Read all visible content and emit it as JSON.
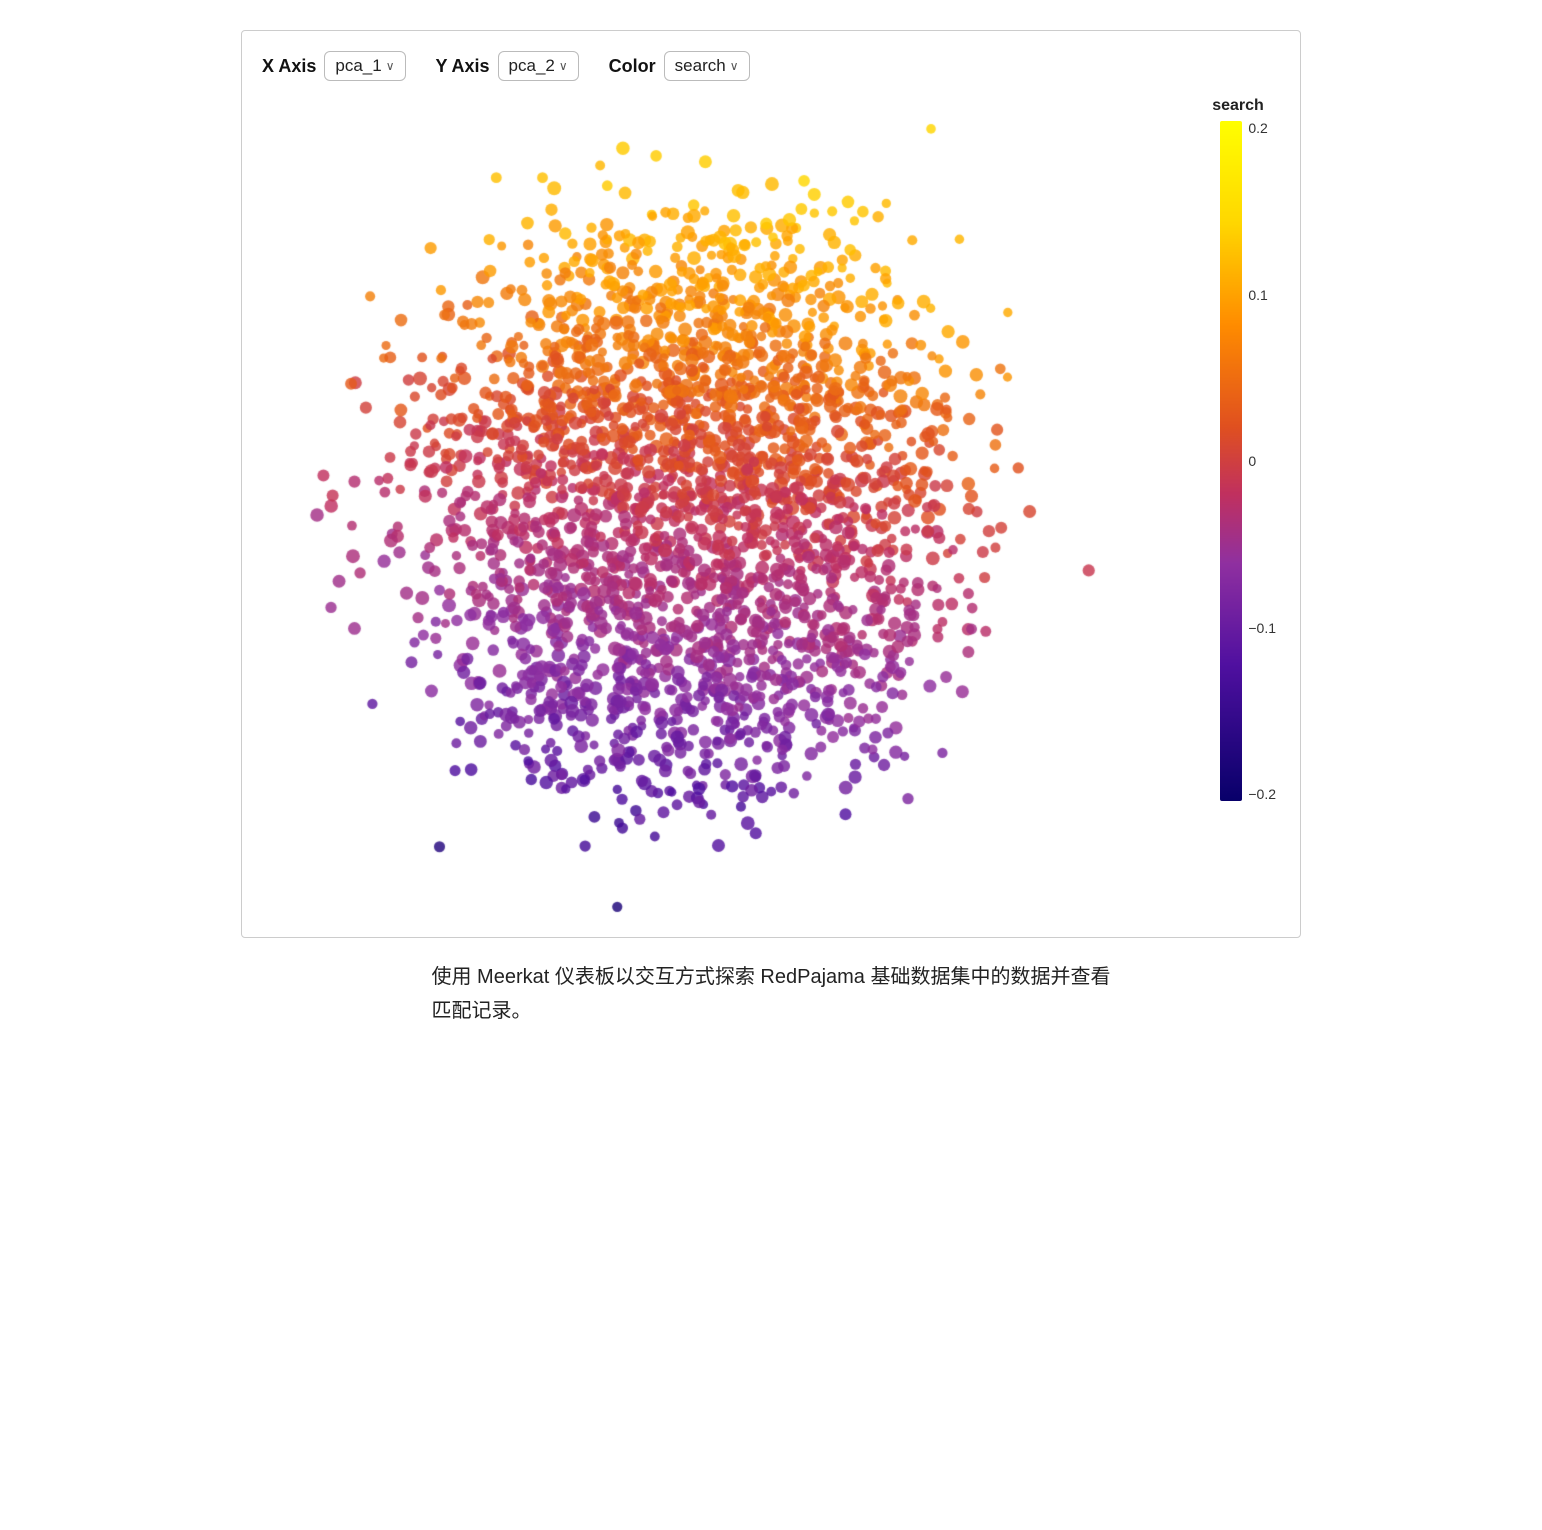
{
  "controls": {
    "xaxis_label": "X Axis",
    "xaxis_value": "pca_1",
    "yaxis_label": "Y Axis",
    "yaxis_value": "pca_2",
    "color_label": "Color",
    "color_value": "search"
  },
  "colorbar": {
    "title": "search",
    "ticks": [
      "0.2",
      "0.1",
      "0",
      "-0.1",
      "-0.2"
    ]
  },
  "description": {
    "line1": "使用 Meerkat 仪表板以交互方式探索 RedPajama 基础数据集中的数据并查看",
    "line2": "匹配记录。"
  }
}
